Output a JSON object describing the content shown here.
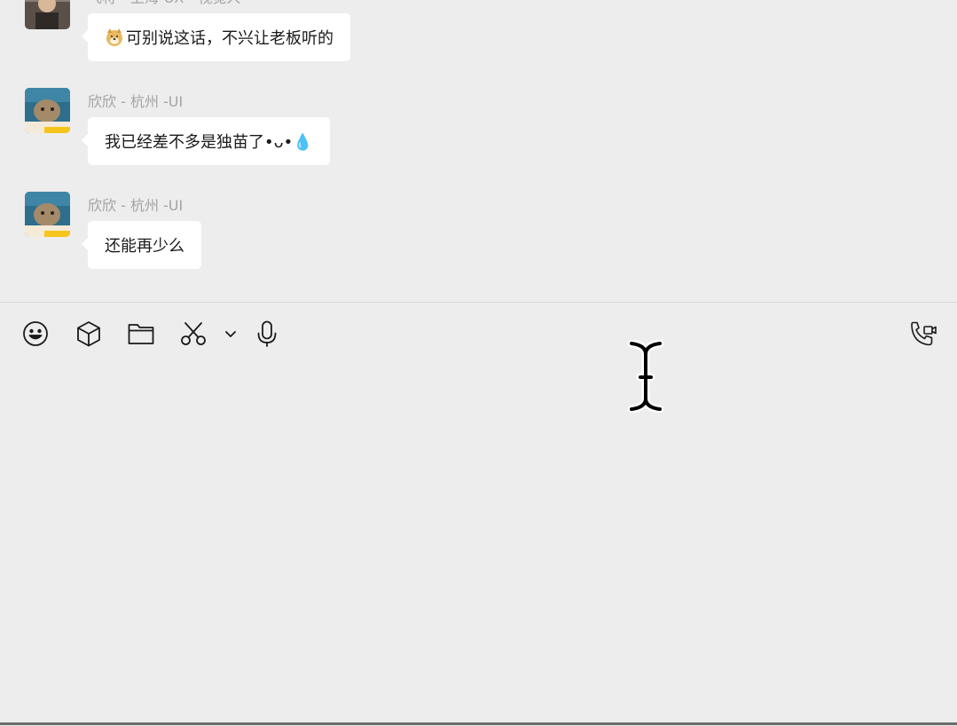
{
  "messages": [
    {
      "sender": "飞将 - 上海-UX - 视觉人",
      "text": "可别说这话，不兴让老板听的",
      "emoji": "doge-face-icon"
    },
    {
      "sender": "欣欣 - 杭州 -UI",
      "text": "我已经差不多是独苗了•ᴗ•💧",
      "emoji": ""
    },
    {
      "sender": "欣欣 - 杭州 -UI",
      "text": "还能再少么",
      "emoji": ""
    }
  ],
  "toolbar": {
    "icons": [
      "emoji-icon",
      "box-icon",
      "folder-icon",
      "scissors-icon",
      "chevron-down-icon",
      "microphone-icon",
      "video-call-icon"
    ]
  },
  "input": {
    "value": "",
    "placeholder": ""
  },
  "colors": {
    "background": "#ededed",
    "bubble": "#ffffff",
    "sender": "#a3a3a3",
    "text": "#1a1a1a",
    "divider": "#d8d8d8"
  }
}
